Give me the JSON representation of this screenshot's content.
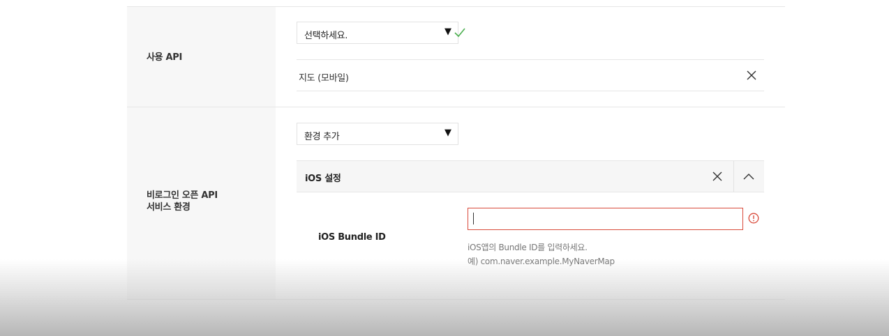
{
  "row_api": {
    "label": "사용 API",
    "select_value": "선택하세요.",
    "select_arrow": "▼",
    "check_icon": "check-icon",
    "selected_items": [
      {
        "label": "지도 (모바일)",
        "remove_icon": "close-icon"
      }
    ]
  },
  "row_env": {
    "label_line1": "비로그인 오픈 API",
    "label_line2": "서비스 환경",
    "select_value": "환경 추가",
    "select_arrow": "▼",
    "ios_section": {
      "title": "iOS 설정",
      "remove_icon": "close-icon",
      "collapse_icon": "chevron-up-icon",
      "bundle_field": {
        "label": "iOS Bundle ID",
        "value": "",
        "help_line1": "iOS앱의 Bundle ID를 입력하세요.",
        "help_line2": "예) com.naver.example.MyNaverMap",
        "error_icon": "alert-circle-icon"
      }
    }
  },
  "colors": {
    "error": "#d94a3a",
    "success": "#4caf50",
    "label_bg": "#f7f7f7"
  }
}
